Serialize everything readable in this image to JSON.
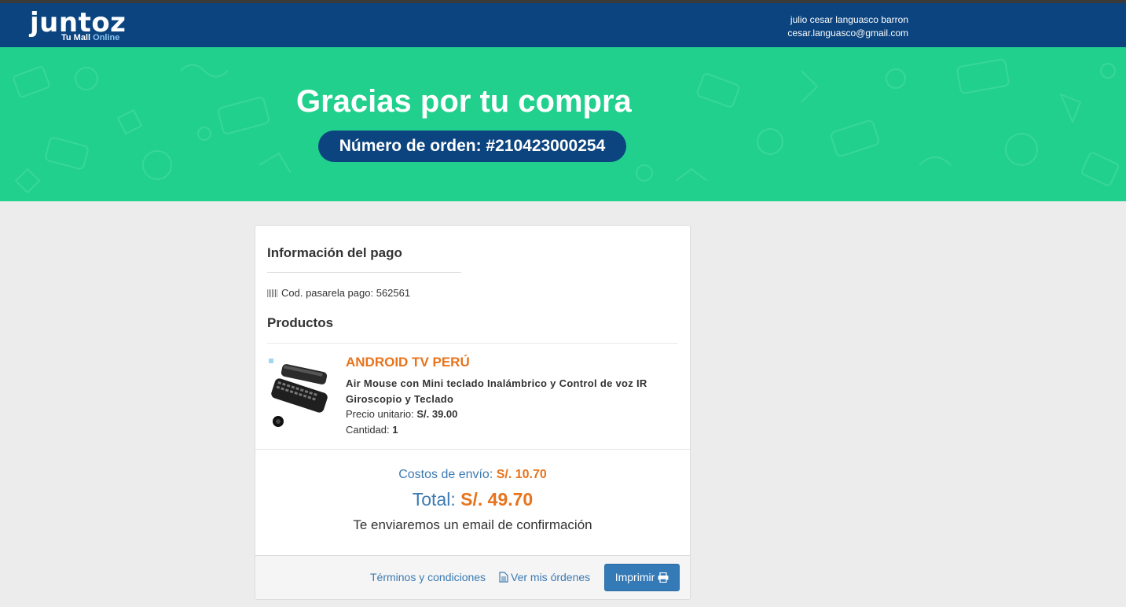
{
  "header": {
    "logo_text": "juntoz",
    "tagline_main": "Tu Mall",
    "tagline_online": "Online",
    "user_name": "julio cesar languasco barron",
    "user_email": "cesar.languasco@gmail.com"
  },
  "hero": {
    "title": "Gracias por tu compra",
    "order_label": "Número de orden: #210423000254"
  },
  "payment": {
    "title": "Información del pago",
    "gateway_label": "Cod. pasarela pago:",
    "gateway_code": "562561"
  },
  "products": {
    "title": "Productos",
    "items": [
      {
        "store": "ANDROID TV PERÚ",
        "description": "Air Mouse con Mini teclado Inalámbrico y Control de voz IR Giroscopio y Teclado",
        "unit_price_label": "Precio unitario:",
        "unit_price": "S/. 39.00",
        "quantity_label": "Cantidad:",
        "quantity": "1"
      }
    ]
  },
  "totals": {
    "shipping_label": "Costos de envío:",
    "shipping_value": "S/. 10.70",
    "total_label": "Total:",
    "total_value": "S/. 49.70",
    "confirmation": "Te enviaremos un email de confirmación"
  },
  "footer": {
    "terms_link": "Términos y condiciones",
    "orders_link": "Ver mis órdenes",
    "print_button": "Imprimir"
  },
  "colors": {
    "header_bg": "#0b447f",
    "hero_bg": "#21d08d",
    "accent_orange": "#e8731b",
    "link_blue": "#3c7ab2",
    "button_blue": "#337ab7"
  },
  "icons": [
    "barcode-icon",
    "document-icon",
    "print-icon"
  ]
}
